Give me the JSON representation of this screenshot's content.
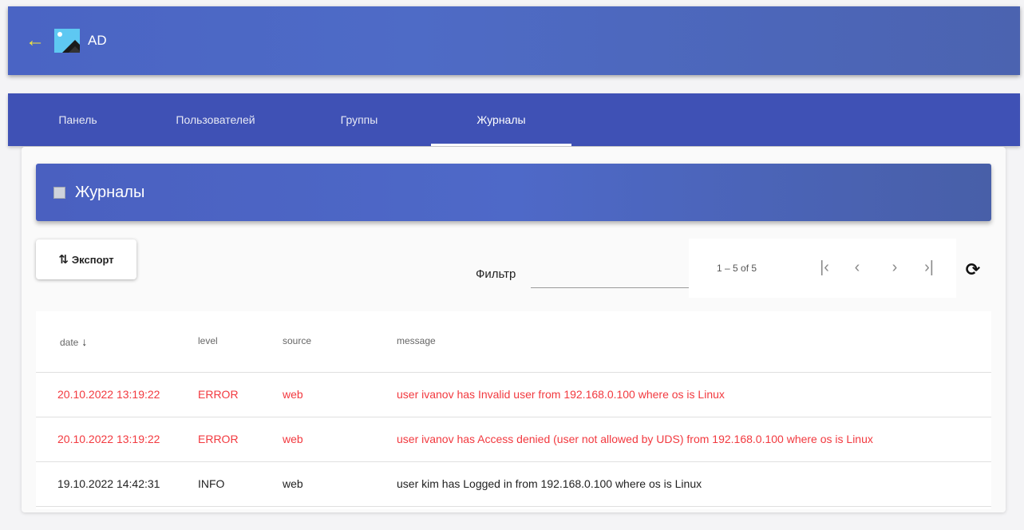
{
  "appbar": {
    "title": "AD",
    "back_icon": "arrow-left-icon",
    "logo": "app-image-logo"
  },
  "tabs": [
    {
      "label": "Панель",
      "active": false
    },
    {
      "label": "Пользователей",
      "active": false
    },
    {
      "label": "Группы",
      "active": false
    },
    {
      "label": "Журналы",
      "active": true
    }
  ],
  "card": {
    "title": "Журналы",
    "title_icon": "square-icon"
  },
  "toolbar": {
    "export_label": "Экспорт",
    "export_icon": "swap-vert-icon",
    "filter_label": "Фильтр",
    "filter_value": "",
    "refresh_icon": "refresh-icon"
  },
  "paginator": {
    "range_label": "1 – 5 of 5",
    "first_icon": "first-page-icon",
    "prev_icon": "chevron-left-icon",
    "next_icon": "chevron-right-icon",
    "last_icon": "last-page-icon"
  },
  "table": {
    "columns": [
      "date",
      "level",
      "source",
      "message"
    ],
    "sort_column": "date",
    "sort_direction": "descending",
    "rows": [
      {
        "date": "20.10.2022 13:19:22",
        "level": "ERROR",
        "source": "web",
        "message": "user ivanov has Invalid user from 192.168.0.100 where os is Linux"
      },
      {
        "date": "20.10.2022 13:19:22",
        "level": "ERROR",
        "source": "web",
        "message": "user ivanov has Access denied (user not allowed by UDS) from 192.168.0.100 where os is Linux"
      },
      {
        "date": "19.10.2022 14:42:31",
        "level": "INFO",
        "source": "web",
        "message": "user kim has Logged in from 192.168.0.100 where os is Linux"
      }
    ]
  },
  "colors": {
    "appbar": "#4e6bc6",
    "tabs_bg": "#3f51b5",
    "error_text": "#f2393f",
    "back_arrow": "#f5e63a"
  }
}
